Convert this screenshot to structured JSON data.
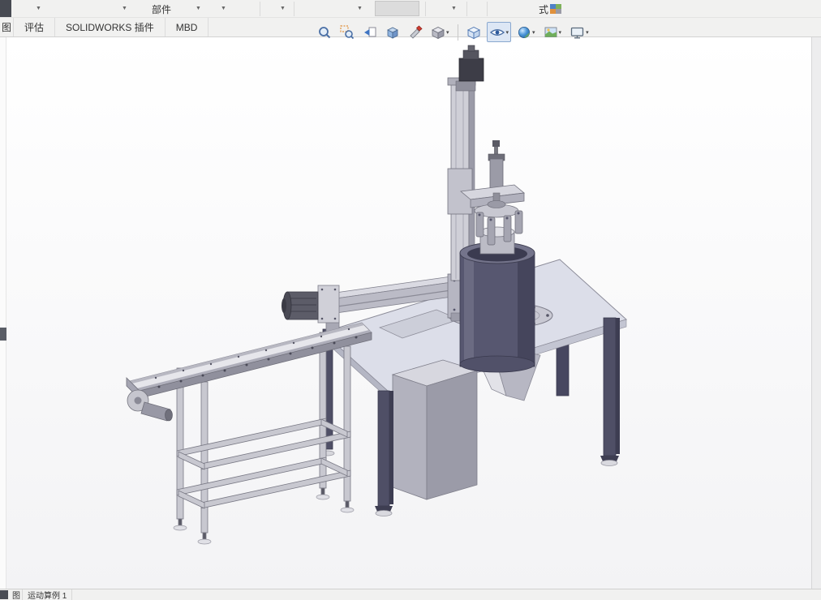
{
  "ribbon": {
    "component_label": "部件",
    "style_label": "式",
    "arrow": "▼"
  },
  "command_tabs": {
    "items": [
      {
        "label": "图"
      },
      {
        "label": "评估"
      },
      {
        "label": "SOLIDWORKS 插件"
      },
      {
        "label": "MBD"
      }
    ]
  },
  "view_toolbar": {
    "dropdown_glyph": "▾",
    "icons": [
      {
        "name": "zoom-fit"
      },
      {
        "name": "zoom-area"
      },
      {
        "name": "previous-view"
      },
      {
        "name": "section-view"
      },
      {
        "name": "measure"
      },
      {
        "name": "display-style",
        "dropdown": true
      },
      {
        "name": "view-orientation"
      },
      {
        "name": "hide-show-items",
        "dropdown": true,
        "active": true
      },
      {
        "name": "edit-appearance",
        "dropdown": true
      },
      {
        "name": "apply-scene",
        "dropdown": true
      },
      {
        "name": "view-settings",
        "dropdown": true
      }
    ]
  },
  "statusbar": {
    "model_tab": "图",
    "motion_study_tab": "运动算例 1"
  },
  "colors": {
    "ui_background": "#f1f1f0",
    "tab_border": "#d2d2d2",
    "viewport_background": "#ffffff",
    "active_tool_fill": "#dde7f5",
    "active_tool_border": "#8aa8cf",
    "model_dark": "#4f4f66",
    "model_mid": "#9b9ba8",
    "model_light": "#dcdee9",
    "drum_color": "#575770",
    "edge_stroke": "#73737f"
  }
}
